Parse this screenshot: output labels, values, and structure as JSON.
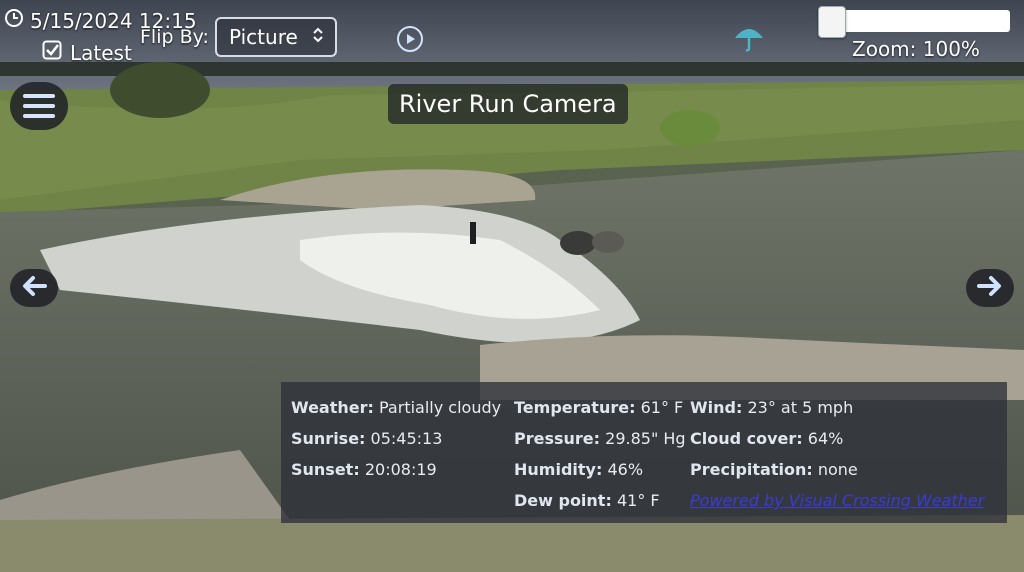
{
  "header": {
    "timestamp": "5/15/2024 12:15",
    "latest_label": "Latest",
    "flip_by_label": "Flip By:",
    "flip_by_value": "Picture",
    "zoom_label": "Zoom: 100%",
    "zoom_level": 0.0
  },
  "title": "River Run Camera",
  "weather": {
    "weather_label": "Weather:",
    "weather_value": "Partially cloudy",
    "temperature_label": "Temperature:",
    "temperature_value": "61° F",
    "wind_label": "Wind:",
    "wind_value": "23° at 5 mph",
    "sunrise_label": "Sunrise:",
    "sunrise_value": "05:45:13",
    "pressure_label": "Pressure:",
    "pressure_value": "29.85\" Hg",
    "cloud_label": "Cloud cover:",
    "cloud_value": "64%",
    "sunset_label": "Sunset:",
    "sunset_value": "20:08:19",
    "humidity_label": "Humidity:",
    "humidity_value": "46%",
    "precip_label": "Precipitation:",
    "precip_value": "none",
    "dew_label": "Dew point:",
    "dew_value": "41° F",
    "powered_by": "Powered by Visual Crossing Weather"
  },
  "colors": {
    "link": "#3b3bd6",
    "accent": "#cfe3ff"
  }
}
